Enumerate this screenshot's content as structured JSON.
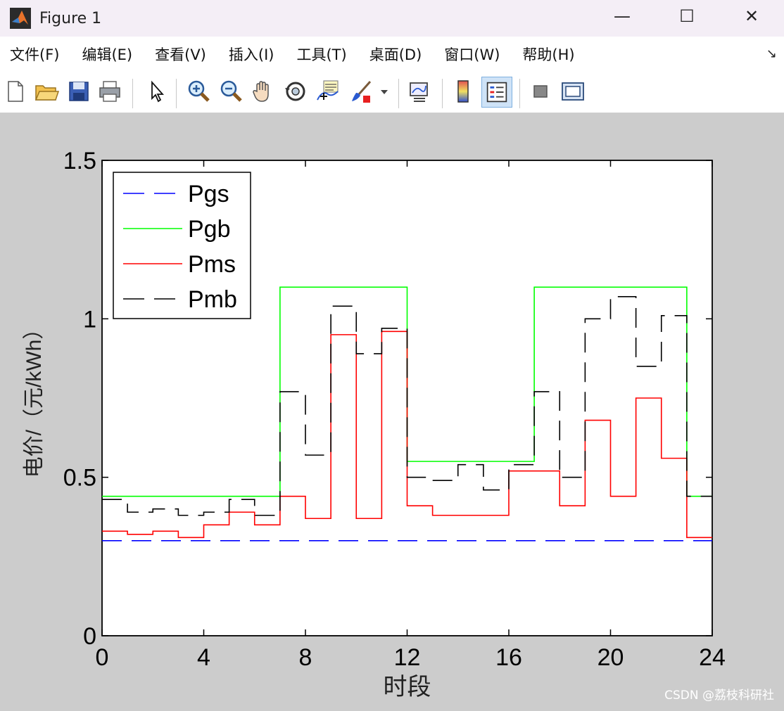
{
  "window": {
    "title": "Figure 1",
    "minimize": "—",
    "maximize": "☐",
    "close": "✕"
  },
  "menu": [
    "文件(F)",
    "编辑(E)",
    "查看(V)",
    "插入(I)",
    "工具(T)",
    "桌面(D)",
    "窗口(W)",
    "帮助(H)"
  ],
  "menu_arrow": "↘",
  "toolbar_icons": [
    "new-figure-icon",
    "open-file-icon",
    "save-icon",
    "print-icon",
    "select-arrow-icon",
    "zoom-in-icon",
    "zoom-out-icon",
    "pan-hand-icon",
    "rotate-3d-icon",
    "data-cursor-icon",
    "brush-icon",
    "dropdown-icon",
    "link-plot-icon",
    "colorbar-icon",
    "legend-icon",
    "hide-plot-tools-icon",
    "show-plot-tools-icon"
  ],
  "watermark": "CSDN @荔枝科研社",
  "chart_data": {
    "type": "line",
    "step": true,
    "xlabel": "时段",
    "ylabel": "电价/（元/kWh）",
    "xlim": [
      0,
      24
    ],
    "ylim": [
      0,
      1.5
    ],
    "xticks": [
      0,
      4,
      8,
      12,
      16,
      20,
      24
    ],
    "yticks": [
      0,
      0.5,
      1,
      1.5
    ],
    "ytick_labels": [
      "0",
      "0.5",
      "1",
      "1.5"
    ],
    "grid": false,
    "legend_position": "top-left",
    "x": [
      0,
      1,
      2,
      3,
      4,
      5,
      6,
      7,
      8,
      9,
      10,
      11,
      12,
      13,
      14,
      15,
      16,
      17,
      18,
      19,
      20,
      21,
      22,
      23,
      24
    ],
    "series": [
      {
        "name": "Pgs",
        "color": "#0000ff",
        "dash": "long-dash",
        "values": [
          0.3,
          0.3,
          0.3,
          0.3,
          0.3,
          0.3,
          0.3,
          0.3,
          0.3,
          0.3,
          0.3,
          0.3,
          0.3,
          0.3,
          0.3,
          0.3,
          0.3,
          0.3,
          0.3,
          0.3,
          0.3,
          0.3,
          0.3,
          0.3,
          0.3
        ]
      },
      {
        "name": "Pgb",
        "color": "#00ff00",
        "dash": "solid",
        "values": [
          0.44,
          0.44,
          0.44,
          0.44,
          0.44,
          0.44,
          0.44,
          1.1,
          1.1,
          1.1,
          1.1,
          1.1,
          0.55,
          0.55,
          0.55,
          0.55,
          0.55,
          1.1,
          1.1,
          1.1,
          1.1,
          1.1,
          1.1,
          0.44,
          0.44
        ]
      },
      {
        "name": "Pms",
        "color": "#ff0000",
        "dash": "solid",
        "values": [
          0.33,
          0.32,
          0.33,
          0.31,
          0.35,
          0.39,
          0.35,
          0.44,
          0.37,
          0.95,
          0.37,
          0.96,
          0.41,
          0.38,
          0.38,
          0.38,
          0.52,
          0.52,
          0.41,
          0.68,
          0.44,
          0.75,
          0.56,
          0.31,
          0.31
        ]
      },
      {
        "name": "Pmb",
        "color": "#000000",
        "dash": "long-dash",
        "values": [
          0.43,
          0.39,
          0.4,
          0.38,
          0.39,
          0.43,
          0.38,
          0.77,
          0.57,
          1.04,
          0.89,
          0.97,
          0.5,
          0.49,
          0.54,
          0.46,
          0.54,
          0.77,
          0.5,
          1.0,
          1.07,
          0.85,
          1.01,
          0.44,
          0.44
        ]
      }
    ]
  }
}
